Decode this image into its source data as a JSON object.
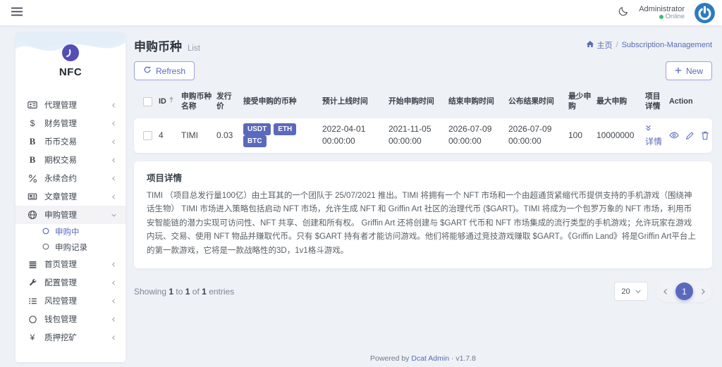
{
  "colors": {
    "accent": "#5b69bd",
    "link": "#586cb1",
    "online_green": "#3dbb7a",
    "badge_bg": "#5b69bd"
  },
  "icons": {
    "dollar": "$",
    "bold_b": "B",
    "baht_b": "B",
    "yen": "¥"
  },
  "topbar": {
    "user_name": "Administrator",
    "user_status": "Online"
  },
  "sidebar": {
    "logo_text": "NFC",
    "items": [
      {
        "label": "代理管理"
      },
      {
        "label": "财务管理"
      },
      {
        "label": "币币交易"
      },
      {
        "label": "期权交易"
      },
      {
        "label": "永续合约"
      },
      {
        "label": "文章管理"
      },
      {
        "label": "申购管理"
      },
      {
        "label": "首页管理"
      },
      {
        "label": "配置管理"
      },
      {
        "label": "风控管理"
      },
      {
        "label": "钱包管理"
      },
      {
        "label": "质押挖矿"
      }
    ],
    "submenu": [
      {
        "label": "申购中",
        "active": true
      },
      {
        "label": "申购记录",
        "active": false
      }
    ]
  },
  "breadcrumb": {
    "home": "主页",
    "separator": "/",
    "current": "Subscription-Management"
  },
  "page": {
    "title": "申购币种",
    "subtitle": "List"
  },
  "toolbar": {
    "refresh_label": "Refresh",
    "new_label": "New"
  },
  "table": {
    "headers": {
      "id": "ID",
      "name": "申购币种名称",
      "price": "发行价",
      "currencies": "接受申购的币种",
      "launch": "预计上线时间",
      "start": "开始申购时间",
      "end": "结束申购时间",
      "publish": "公布结果时间",
      "min": "最少申购",
      "max": "最大申购",
      "detail": "项目详情",
      "action": "Action"
    },
    "row": {
      "id": "4",
      "name": "TIMI",
      "price": "0.03",
      "currencies": [
        "USDT",
        "ETH",
        "BTC"
      ],
      "launch": "2022-04-01 00:00:00",
      "start": "2021-11-05 00:00:00",
      "end": "2026-07-09 00:00:00",
      "publish": "2026-07-09 00:00:00",
      "min": "100",
      "max": "10000000",
      "detail_label": "详情"
    }
  },
  "details": {
    "title": "项目详情",
    "body": "TIMI （项目总发行量100亿）由土耳其的一个团队于 25/07/2021 推出。TIMI 将拥有一个 NFT 市场和一个由超通货紧缩代币提供支持的手机游戏（围绕神话生物） TIMI 市场进入策略包括启动 NFT 市场，允许生成 NFT 和 Griffin Art 社区的治理代币 ($GART)。TIMI 将成为一个包罗万象的 NFT 市场，利用币安智能链的潜力实现可访问性、NFT 共享、创建和所有权。 Griffin Art 还将创建与 $GART 代币和 NFT 市场集成的流行类型的手机游戏；允许玩家在游戏内玩、交易、使用 NFT 物品并赚取代币。只有 $GART 持有者才能访问游戏。他们将能够通过竞技游戏赚取 $GART。《Griffin Land》将是Griffin Art平台上的第一款游戏，它将是一款战略性的3D，1v1格斗游戏。"
  },
  "pagination": {
    "showing": {
      "t0": "Showing",
      "n1": "1",
      "t1": "to",
      "n2": "1",
      "t2": "of",
      "n3": "1",
      "t3": "entries"
    },
    "per_page": "20",
    "page": "1"
  },
  "footer": {
    "prefix": "Powered by",
    "link": "Dcat Admin",
    "dot": "·",
    "version": "v1.7.8"
  }
}
